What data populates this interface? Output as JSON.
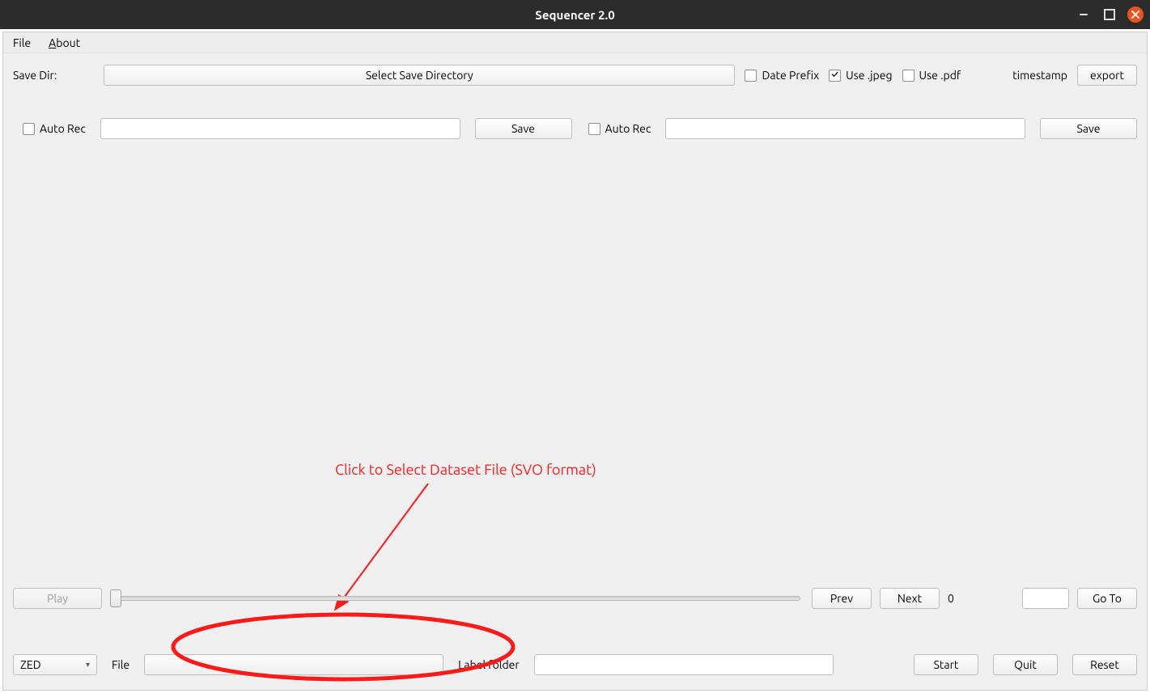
{
  "titlebar": {
    "title": "Sequencer 2.0"
  },
  "menu": {
    "file": "File",
    "about_prefix": "A",
    "about_rest": "bout"
  },
  "topbar": {
    "save_dir_label": "Save Dir:",
    "select_dir_btn": "Select Save Directory",
    "date_prefix_label": "Date Prefix",
    "use_jpeg_label": "Use .jpeg",
    "use_pdf_label": "Use .pdf",
    "timestamp_label": "timestamp",
    "export_btn": "export",
    "date_prefix_checked": false,
    "use_jpeg_checked": true,
    "use_pdf_checked": false
  },
  "rec": {
    "auto_rec_label": "Auto Rec",
    "save_btn": "Save",
    "left": {
      "checked": false,
      "value": ""
    },
    "right": {
      "checked": false,
      "value": ""
    }
  },
  "playback": {
    "play_btn": "Play",
    "prev_btn": "Prev",
    "next_btn": "Next",
    "position": "0",
    "goto_value": "",
    "goto_btn": "Go To"
  },
  "bottom": {
    "source_selected": "ZED",
    "file_label": "File",
    "file_value": "",
    "label_folder_label": "Label folder",
    "label_folder_value": "",
    "start_btn": "Start",
    "quit_btn": "Quit",
    "reset_btn": "Reset"
  },
  "annotation": {
    "text": "Click to Select Dataset File (SVO format)"
  }
}
